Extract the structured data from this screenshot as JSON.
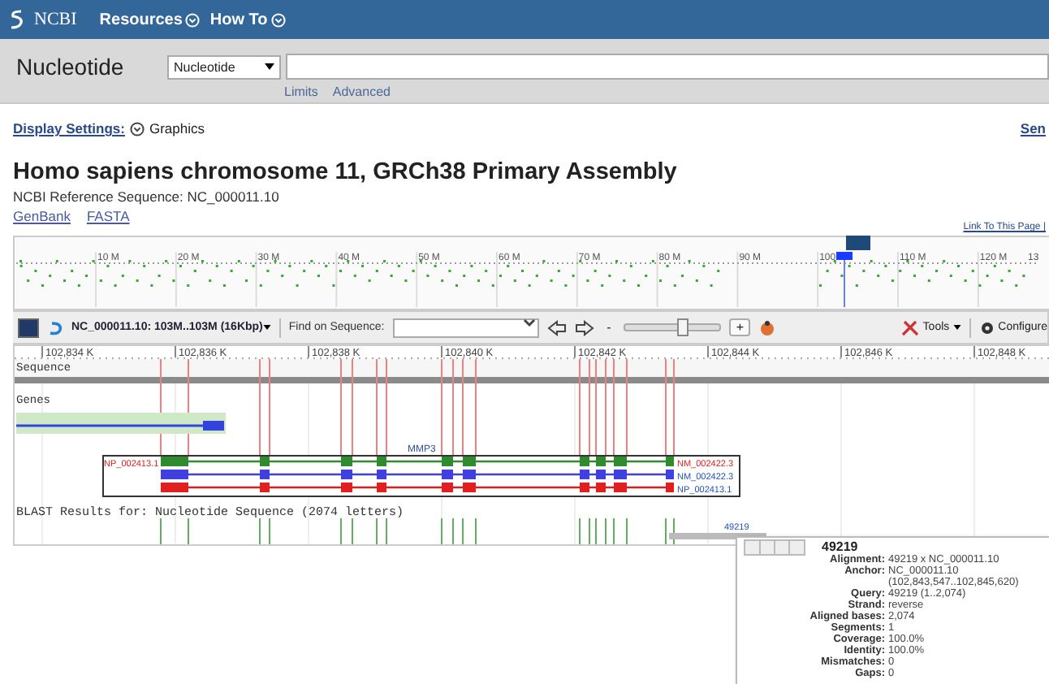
{
  "header": {
    "logo": "NCBI",
    "menus": [
      "Resources",
      "How To"
    ]
  },
  "search": {
    "database_label": "Nucleotide",
    "database_select": "Nucleotide",
    "links": [
      "Limits",
      "Advanced"
    ]
  },
  "display_settings": {
    "label": "Display Settings:",
    "value": "Graphics",
    "right_link": "Sen"
  },
  "title": "Homo sapiens chromosome 11, GRCh38 Primary Assembly",
  "subtitle": "NCBI Reference Sequence: NC_000011.10",
  "format_links": [
    "GenBank",
    "FASTA"
  ],
  "page_link": "Link To This Page |",
  "overview": {
    "ticks": [
      "10 M",
      "20 M",
      "30 M",
      "40 M",
      "50 M",
      "60 M",
      "70 M",
      "80 M",
      "90 M",
      "100",
      "110 M",
      "120 M",
      "13"
    ]
  },
  "toolbar": {
    "sequence": "NC_000011.10: 103M..103M (16Kbp)",
    "find_label": "Find on Sequence:",
    "zoom_out": "-",
    "zoom_in": "+",
    "zoom": {
      "level": 0.6
    },
    "tools": "Tools",
    "configure": "Configure"
  },
  "ruler": {
    "ticks": [
      "102,834 K",
      "102,836 K",
      "102,838 K",
      "102,840 K",
      "102,842 K",
      "102,844 K",
      "102,846 K",
      "102,848 K"
    ]
  },
  "tracks": {
    "sequence_label": "Sequence",
    "genes_label": "Genes",
    "gene_name": "MMP3",
    "transcripts": [
      {
        "left_label": {
          "text": "NP_002413.1",
          "color": "#e02020"
        },
        "right_label": {
          "text": "NM_002422.3",
          "color": "#e02020"
        },
        "color": "#2e8b2e"
      },
      {
        "right_label": {
          "text": "NM_002422.3",
          "color": "#2050c0"
        },
        "color": "#4040e0"
      },
      {
        "right_label": {
          "text": "NP_002413.1",
          "color": "#2050c0"
        },
        "color": "#e02020"
      }
    ],
    "blast_title": "BLAST Results for: Nucleotide Sequence (2074 letters)",
    "hit_label": "49219"
  },
  "tooltip": {
    "title": "49219",
    "rows": [
      {
        "label": "Alignment:",
        "value": "49219 x NC_000011.10"
      },
      {
        "label": "Anchor:",
        "value": "NC_000011.10"
      },
      {
        "label": "",
        "value": "(102,843,547..102,845,620)"
      },
      {
        "label": "Query:",
        "value": "49219 (1..2,074)"
      },
      {
        "label": "Strand:",
        "value": "reverse"
      },
      {
        "label": "Aligned bases:",
        "value": "2,074"
      },
      {
        "label": "Segments:",
        "value": "1"
      },
      {
        "label": "Coverage:",
        "value": "100.0%"
      },
      {
        "label": "Identity:",
        "value": "100.0%"
      },
      {
        "label": "Mismatches:",
        "value": "0"
      },
      {
        "label": "Gaps:",
        "value": "0"
      }
    ]
  }
}
